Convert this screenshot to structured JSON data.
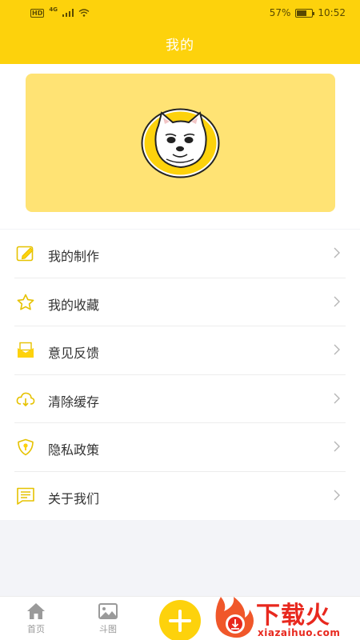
{
  "status_bar": {
    "hd": "HD",
    "network": "4G",
    "battery_percent": "57%",
    "battery_level": 0.57,
    "time": "10:52"
  },
  "header": {
    "title": "我的"
  },
  "colors": {
    "brand_yellow": "#fdd20c",
    "card_yellow": "#ffe374",
    "watermark_red": "#e8281e"
  },
  "menu": {
    "items": [
      {
        "label": "我的制作",
        "icon": "edit-icon"
      },
      {
        "label": "我的收藏",
        "icon": "star-icon"
      },
      {
        "label": "意见反馈",
        "icon": "mail-icon"
      },
      {
        "label": "清除缓存",
        "icon": "cloud-download-icon"
      },
      {
        "label": "隐私政策",
        "icon": "shield-icon"
      },
      {
        "label": "关于我们",
        "icon": "document-icon"
      }
    ]
  },
  "tabbar": {
    "tabs": [
      {
        "label": "首页",
        "icon": "home-icon"
      },
      {
        "label": "斗图",
        "icon": "image-icon"
      }
    ],
    "fab_icon": "plus-icon"
  },
  "watermark": {
    "logo_text": "下载火",
    "url": "xiazaihuo.com"
  }
}
